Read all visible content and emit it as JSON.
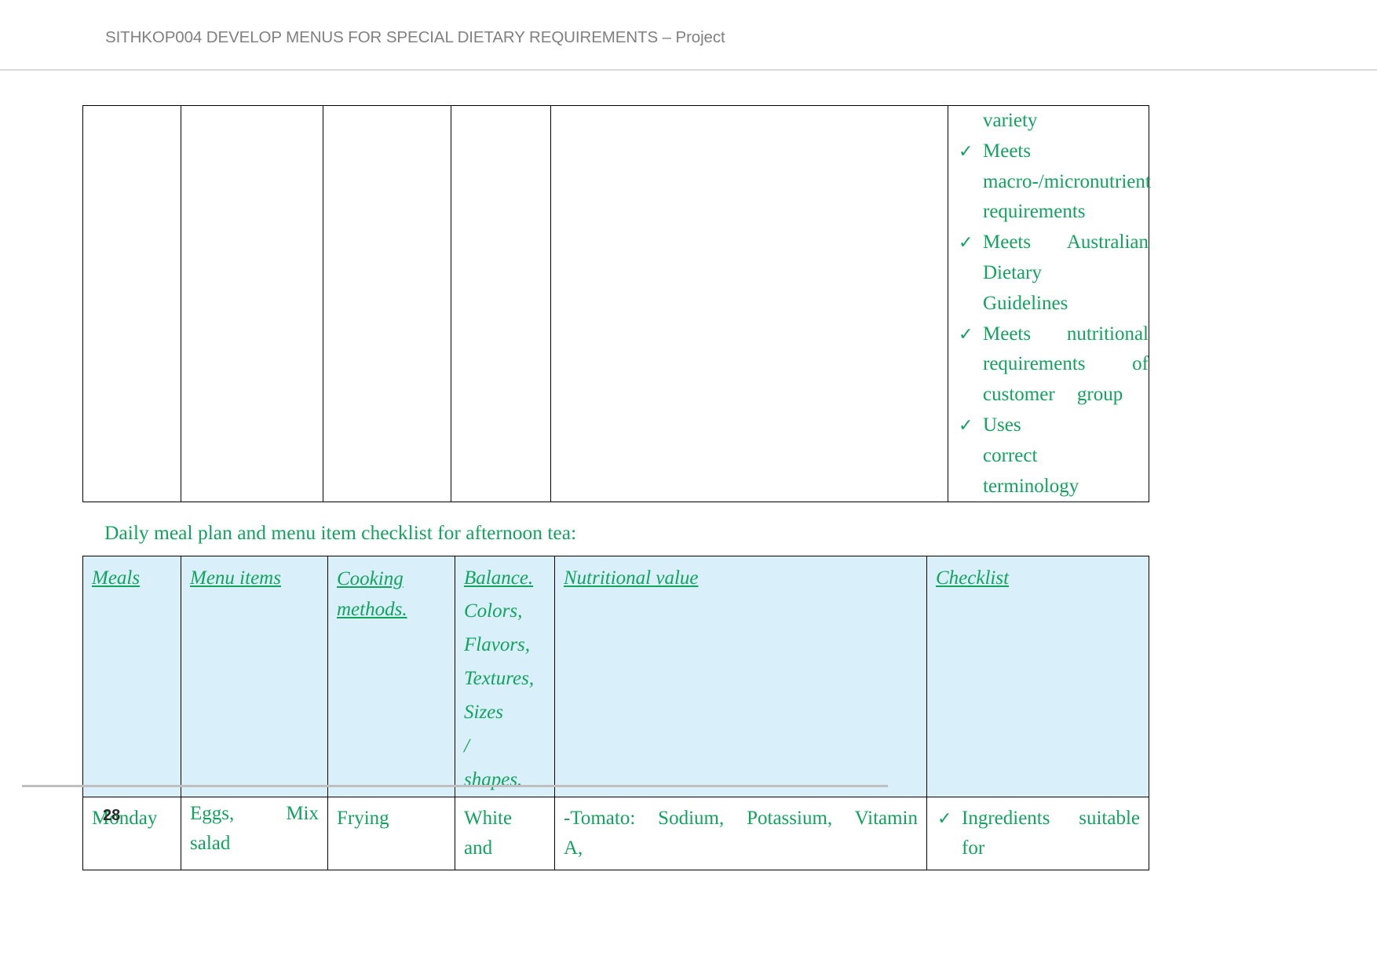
{
  "document": {
    "header_title": "SITHKOP004 DEVELOP MENUS FOR SPECIAL DIETARY REQUIREMENTS – Project",
    "page_number": "28",
    "accent_green": "#12a35d",
    "header_gray": "#808080",
    "table_header_fill": "#d9effa"
  },
  "table_continued": {
    "columns": 6,
    "empty_cells": [
      "",
      "",
      "",
      "",
      ""
    ],
    "checklist_cell": {
      "continuation_line": "variety",
      "items": [
        {
          "tick": "✓",
          "text": "Meets macro-/micronutrient requirements"
        },
        {
          "tick": "✓",
          "text": "Meets Australian Dietary Guidelines"
        },
        {
          "tick": "✓",
          "text": "Meets nutritional requirements of customer group"
        },
        {
          "tick": "✓",
          "text": "Uses correct terminology"
        }
      ]
    }
  },
  "caption": "Daily meal plan and menu item checklist for afternoon tea:",
  "table_afternoon_tea": {
    "headers": [
      {
        "title": "Meals",
        "sub": []
      },
      {
        "title": "Menu items",
        "sub": []
      },
      {
        "title": "Cooking methods.",
        "sub": []
      },
      {
        "title": "Balance.",
        "sub": [
          "Colors,",
          "Flavors,",
          "Textures,",
          "Sizes /",
          "shapes."
        ]
      },
      {
        "title": "Nutritional value",
        "sub": []
      },
      {
        "title": "Checklist",
        "sub": []
      }
    ],
    "rows": [
      {
        "meals": "Monday",
        "menu_items": "Eggs, Mix salad",
        "cooking_methods": "Frying",
        "balance": "White and",
        "nutritional_value": "-Tomato: Sodium, Potassium, Vitamin A,",
        "checklist_tick": "✓",
        "checklist": "Ingredients suitable for"
      }
    ]
  }
}
